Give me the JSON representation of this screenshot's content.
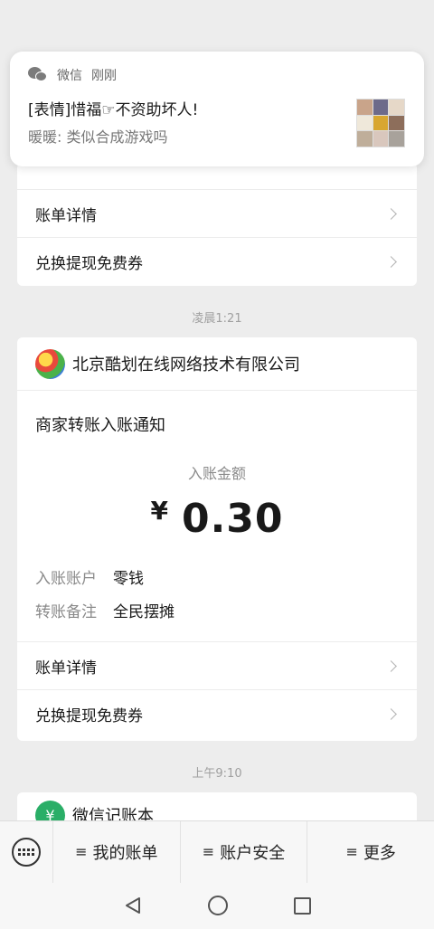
{
  "notification": {
    "app_name": "微信",
    "time": "刚刚",
    "title": "[表情]惜福☞不资助坏人!",
    "body": "暖暖: 类似合成游戏吗"
  },
  "top_card": {
    "rows": [
      {
        "label": "账单详情"
      },
      {
        "label": "兑换提现免费券"
      }
    ]
  },
  "timestamp_1": "凌晨1:21",
  "transfer_card": {
    "merchant": "北京酷划在线网络技术有限公司",
    "title": "商家转账入账通知",
    "amount_label": "入账金额",
    "currency": "¥",
    "amount": "0.30",
    "account_key": "入账账户",
    "account_value": "零钱",
    "note_key": "转账备注",
    "note_value": "全民摆摊",
    "rows": [
      {
        "label": "账单详情"
      },
      {
        "label": "兑换提现免费券"
      }
    ]
  },
  "timestamp_2": "上午9:10",
  "next_card": {
    "title": "微信记账本",
    "icon_glyph": "¥"
  },
  "bottom_menu": {
    "items": [
      {
        "label": "我的账单"
      },
      {
        "label": "账户安全"
      },
      {
        "label": "更多"
      }
    ],
    "menu_glyph": "≡"
  },
  "colors": {
    "background": "#ededed",
    "wechat_green": "#2aae67"
  }
}
